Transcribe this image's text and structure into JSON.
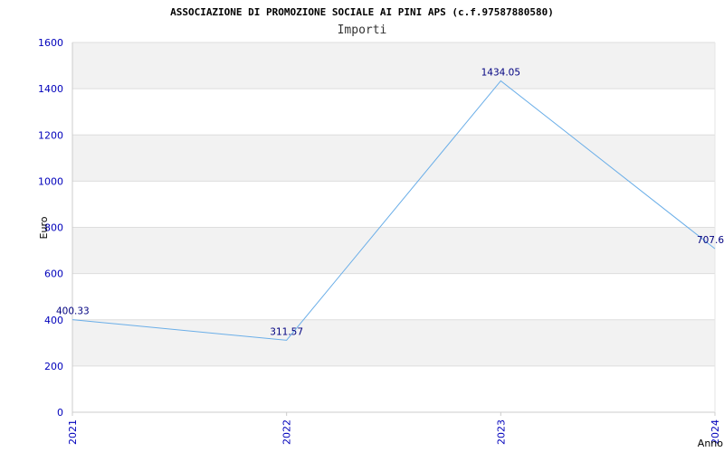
{
  "chart_data": {
    "type": "line",
    "title": "ASSOCIAZIONE DI PROMOZIONE SOCIALE AI PINI APS (c.f.97587880580)",
    "subtitle": "Importi",
    "xlabel": "Anno",
    "ylabel": "Euro",
    "categories": [
      "2021",
      "2022",
      "2023",
      "2024"
    ],
    "series": [
      {
        "values": [
          400.33,
          311.57,
          1434.05,
          707.6
        ],
        "labels": [
          "400.33",
          "311.57",
          "1434.05",
          "707.6"
        ],
        "color": "#6aaee8"
      }
    ],
    "ylim": [
      0,
      1600
    ],
    "yticks": [
      0,
      200,
      400,
      600,
      800,
      1000,
      1200,
      1400,
      1600
    ],
    "grid": true,
    "band_color": "#f2f2f2",
    "grid_color": "#dddddd"
  }
}
